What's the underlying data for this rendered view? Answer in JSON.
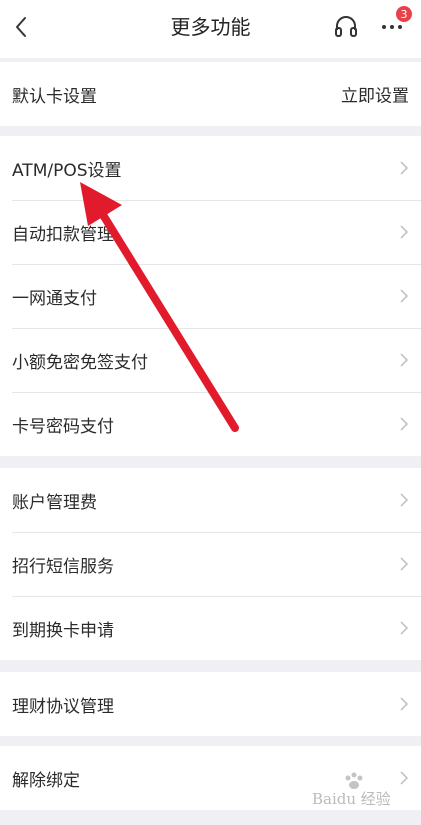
{
  "header": {
    "title": "更多功能",
    "badge_count": "3",
    "back_icon": "chevron-left",
    "service_icon": "headset",
    "more_icon": "ellipsis"
  },
  "groups": [
    {
      "rows": [
        {
          "label": "默认卡设置",
          "value": "立即设置"
        }
      ]
    },
    {
      "rows": [
        {
          "label": "ATM/POS设置"
        },
        {
          "label": "自动扣款管理"
        },
        {
          "label": "一网通支付"
        },
        {
          "label": "小额免密免签支付"
        },
        {
          "label": "卡号密码支付"
        }
      ]
    },
    {
      "rows": [
        {
          "label": "账户管理费"
        },
        {
          "label": "招行短信服务"
        },
        {
          "label": "到期换卡申请"
        }
      ]
    },
    {
      "rows": [
        {
          "label": "理财协议管理"
        }
      ]
    },
    {
      "rows": [
        {
          "label": "解除绑定"
        }
      ]
    }
  ],
  "colors": {
    "background": "#efeff4",
    "badge": "#e8414a",
    "annotation_arrow": "#e21b2c",
    "chevron": "#c4c4c4"
  },
  "watermark": {
    "text": "Baidu 经验"
  }
}
